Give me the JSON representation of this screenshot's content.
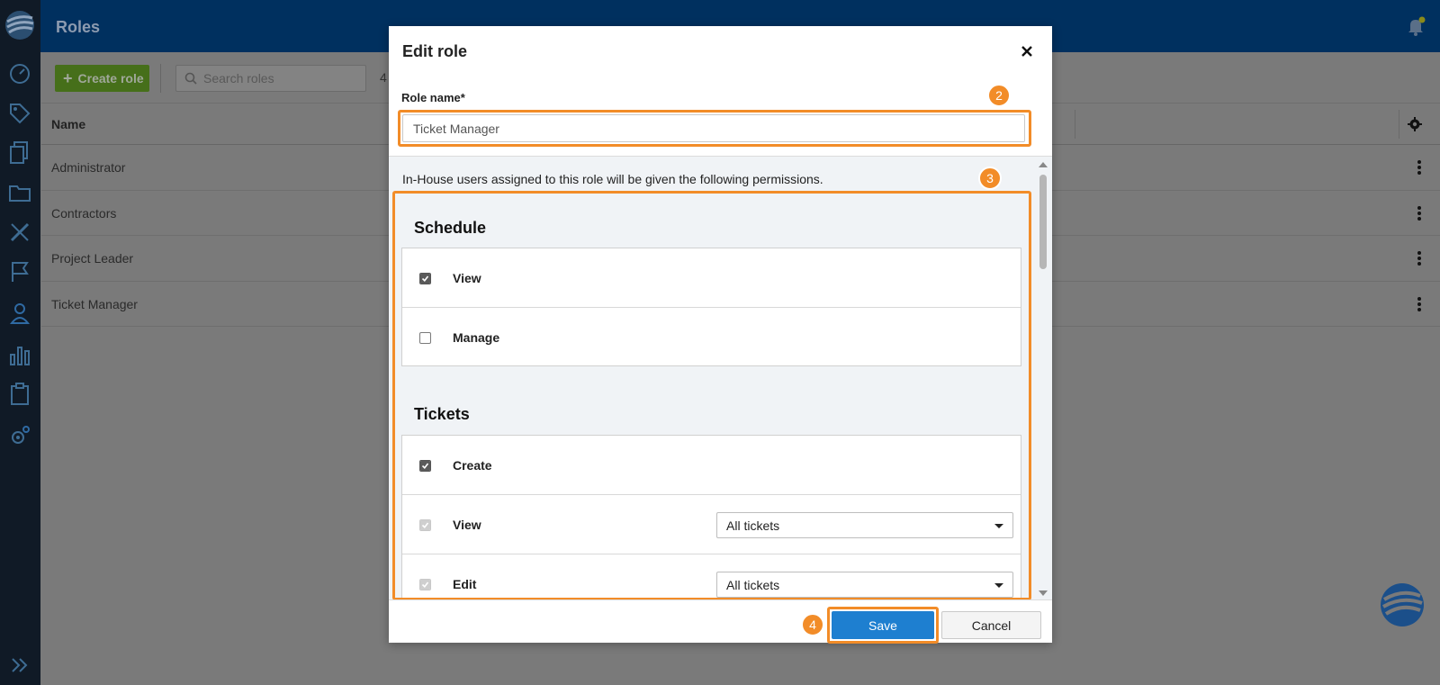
{
  "app": {
    "page_title": "Roles",
    "nav_icons": [
      "dashboard-icon",
      "tags-icon",
      "documents-icon",
      "folder-icon",
      "tools-icon",
      "flag-icon",
      "user-icon",
      "chart-icon",
      "clipboard-icon",
      "settings-icon"
    ]
  },
  "toolbar": {
    "create_label": "Create role",
    "search_placeholder": "Search roles",
    "count": "4"
  },
  "table": {
    "header_name": "Name",
    "rows": [
      {
        "name": "Administrator"
      },
      {
        "name": "Contractors"
      },
      {
        "name": "Project Leader"
      },
      {
        "name": "Ticket Manager"
      }
    ]
  },
  "modal": {
    "title": "Edit role",
    "role_name_label": "Role name*",
    "role_name_value": "Ticket Manager",
    "intro": "In-House users assigned to this role will be given the following permissions.",
    "sections": [
      {
        "title": "Schedule",
        "permissions": [
          {
            "label": "View",
            "checked": true
          },
          {
            "label": "Manage",
            "checked": false
          }
        ]
      },
      {
        "title": "Tickets",
        "permissions": [
          {
            "label": "Create",
            "checked": true
          },
          {
            "label": "View",
            "checked": true,
            "disabled": true,
            "scope": "All tickets"
          },
          {
            "label": "Edit",
            "checked": true,
            "disabled": true,
            "scope": "All tickets"
          }
        ]
      }
    ],
    "save_label": "Save",
    "cancel_label": "Cancel"
  },
  "annotations": {
    "step_name": "2",
    "step_permissions": "3",
    "step_save": "4"
  },
  "colors": {
    "accent_highlight": "#f28c28",
    "primary_button": "#1e7fd0",
    "topbar": "#00305f",
    "sidebar": "#101a26",
    "create_button": "#466f1a"
  }
}
